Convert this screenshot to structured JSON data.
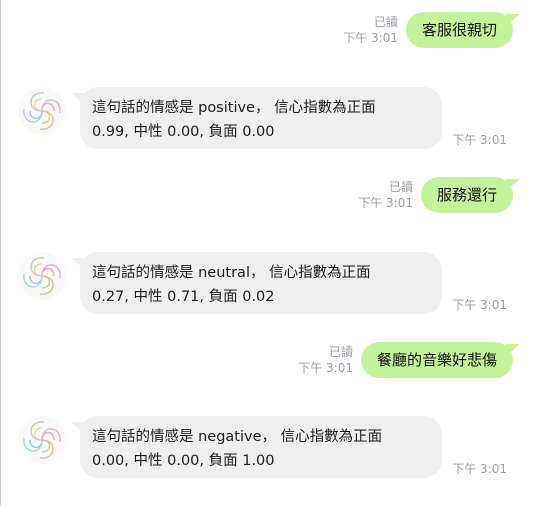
{
  "messages": [
    {
      "direction": "out",
      "text": "客服很親切",
      "read_label": "已讀",
      "time": "下午 3:01"
    },
    {
      "direction": "in",
      "line1": "這句話的情感是 positive， 信心指數為正面",
      "line2": "0.99, 中性 0.00, 負面 0.00",
      "time": "下午 3:01",
      "avatar_icon": "swirl-logo-icon"
    },
    {
      "direction": "out",
      "text": "服務還行",
      "read_label": "已讀",
      "time": "下午 3:01"
    },
    {
      "direction": "in",
      "line1": "這句話的情感是 neutral， 信心指數為正面",
      "line2": "0.27, 中性 0.71, 負面 0.02",
      "time": "下午 3:01",
      "avatar_icon": "swirl-logo-icon"
    },
    {
      "direction": "out",
      "text": "餐廳的音樂好悲傷",
      "read_label": "已讀",
      "time": "下午 3:01"
    },
    {
      "direction": "in",
      "line1": "這句話的情感是 negative， 信心指數為正面",
      "line2": "0.00, 中性 0.00, 負面 1.00",
      "time": "下午 3:01",
      "avatar_icon": "swirl-logo-icon"
    }
  ],
  "colors": {
    "outgoing_bubble": "#c4f39b",
    "incoming_bubble": "#efefef",
    "meta_text": "#9aa0a6"
  }
}
